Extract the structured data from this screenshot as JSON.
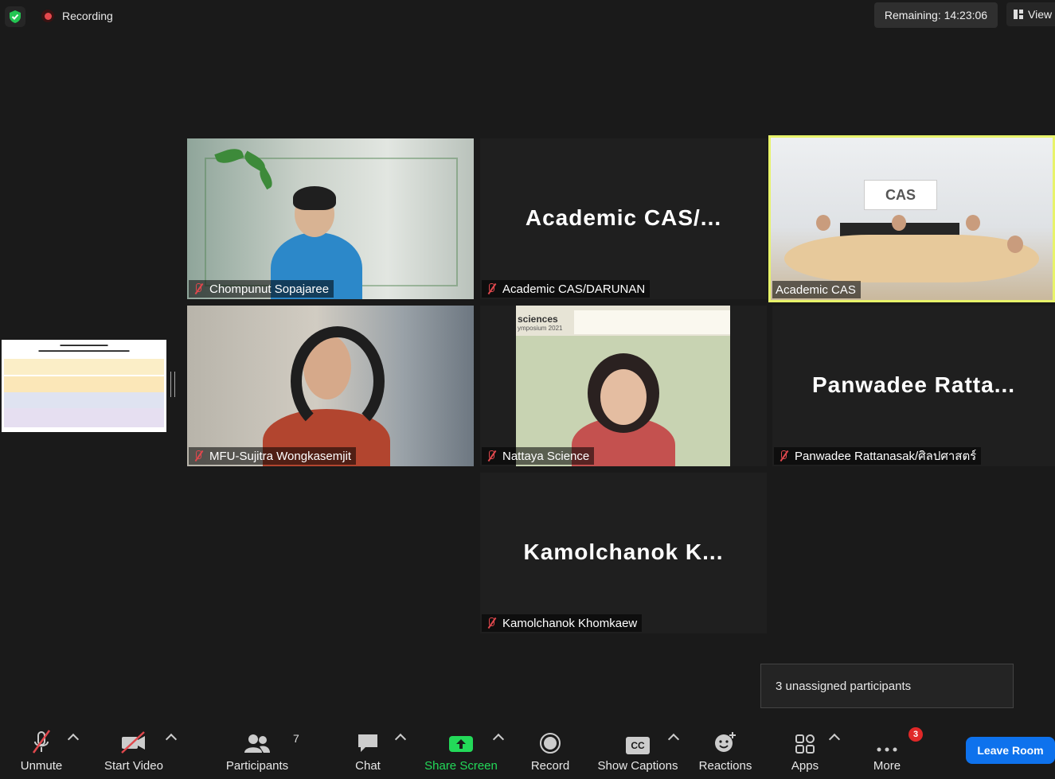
{
  "top": {
    "recording_label": "Recording",
    "remaining": "Remaining: 14:23:06",
    "view_label": "View"
  },
  "tiles": [
    {
      "name": "Chompunut Sopajaree",
      "big": ""
    },
    {
      "name": "Academic CAS/DARUNAN",
      "big": "Academic  CAS/..."
    },
    {
      "name": "Academic CAS",
      "big": ""
    },
    {
      "name": "MFU-Sujitra Wongkasemjit",
      "big": ""
    },
    {
      "name": "Nattaya Science",
      "big": ""
    },
    {
      "name": "Panwadee Rattanasak/ศิลปศาสตร์",
      "big": "Panwadee  Ratta..."
    },
    {
      "name": "Kamolchanok Khomkaew",
      "big": "Kamolchanok  K..."
    }
  ],
  "video_text": {
    "cas_logo": "CAS",
    "nattaya_banner_1": "sciences",
    "nattaya_banner_2": "ymposium 2021"
  },
  "tooltip": "3 unassigned participants",
  "toolbar": {
    "unmute": "Unmute",
    "start_video": "Start Video",
    "participants": "Participants",
    "participants_count": "7",
    "chat": "Chat",
    "share_screen": "Share Screen",
    "record": "Record",
    "show_captions": "Show Captions",
    "captions_icon": "CC",
    "reactions": "Reactions",
    "apps": "Apps",
    "more": "More",
    "more_badge": "3",
    "leave": "Leave Room"
  },
  "colors": {
    "share_green": "#23d959",
    "leave_blue": "#0e72ed",
    "active_speaker": "#e8f36a",
    "mute_red": "#e0484d"
  }
}
